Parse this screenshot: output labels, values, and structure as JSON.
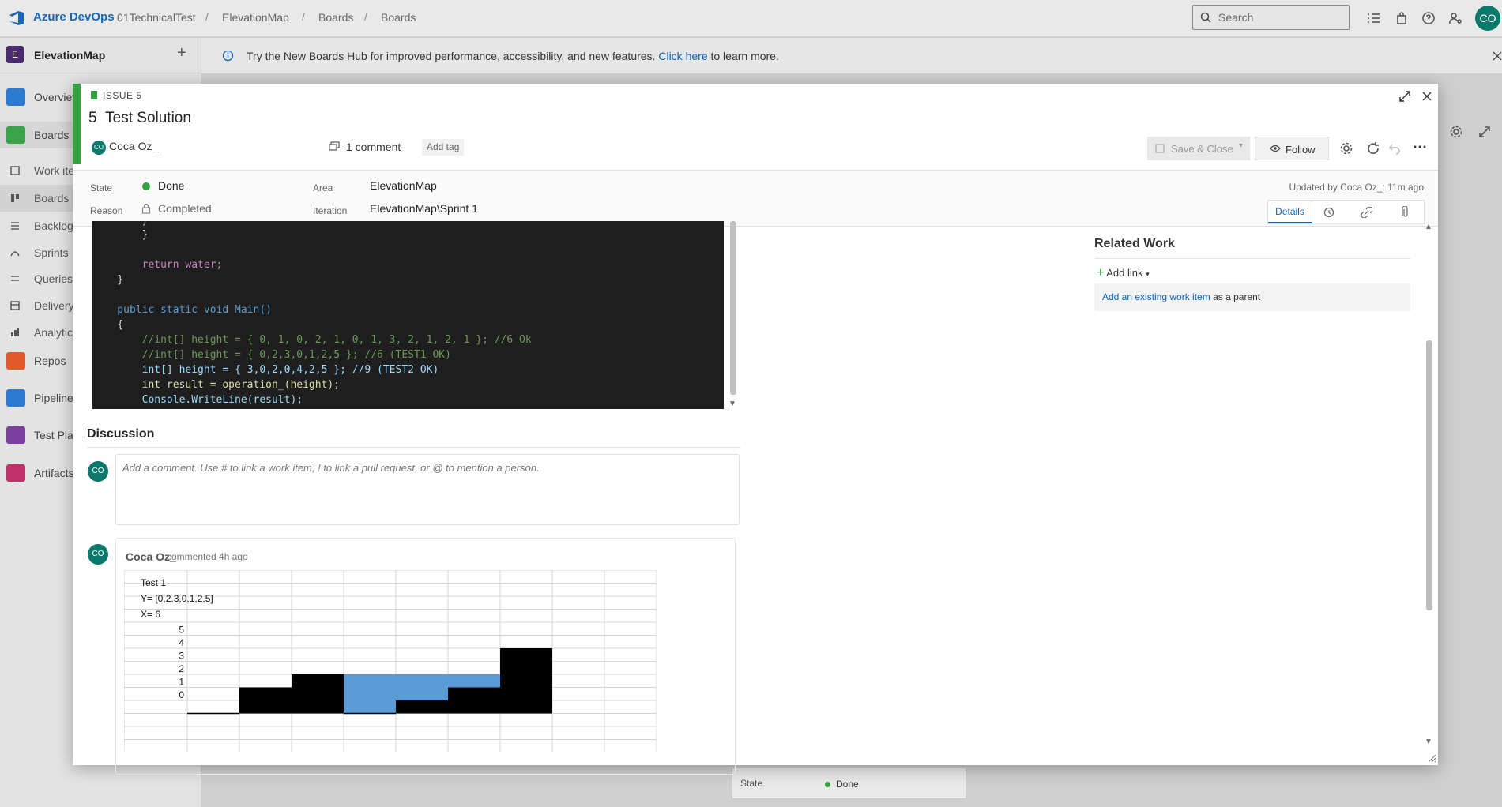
{
  "topbar": {
    "brand": "Azure DevOps",
    "breadcrumbs": [
      "01TechnicalTest",
      "ElevationMap",
      "Boards",
      "Boards"
    ],
    "search_placeholder": "Search",
    "avatar_initials": "CO"
  },
  "sidebar": {
    "project_initial": "E",
    "project_name": "ElevationMap",
    "items": [
      {
        "label": "Overview",
        "color": "#2b7bd0"
      },
      {
        "label": "Boards",
        "color": "#3aa44a"
      },
      {
        "label": "Work items",
        "color": ""
      },
      {
        "label": "Boards",
        "color": ""
      },
      {
        "label": "Backlogs",
        "color": ""
      },
      {
        "label": "Sprints",
        "color": ""
      },
      {
        "label": "Queries",
        "color": ""
      },
      {
        "label": "Delivery Plans",
        "color": ""
      },
      {
        "label": "Analytics views",
        "color": ""
      },
      {
        "label": "Repos",
        "color": "#e05a2a"
      },
      {
        "label": "Pipelines",
        "color": "#2b7bd0"
      },
      {
        "label": "Test Plans",
        "color": "#7b3fa0"
      },
      {
        "label": "Artifacts",
        "color": "#c0306a"
      }
    ]
  },
  "banner": {
    "text_before": "Try the New Boards Hub for improved performance, accessibility, and new features.",
    "link": "Click here",
    "text_after": "to learn more."
  },
  "work_item": {
    "type": "ISSUE 5",
    "id": "5",
    "title": "Test Solution",
    "assignee": "Coca Oz_",
    "assignee_initials": "CO",
    "comments": "1 comment",
    "add_tag": "Add tag",
    "save_close": "Save & Close",
    "follow": "Follow",
    "fields": {
      "state_label": "State",
      "state": "Done",
      "reason_label": "Reason",
      "reason": "Completed",
      "area_label": "Area",
      "area": "ElevationMap",
      "iteration_label": "Iteration",
      "iteration": "ElevationMap\\Sprint 1"
    },
    "updated": "Updated by Coca Oz_: 11m ago",
    "tab_details": "Details",
    "status_color": "#35a241"
  },
  "code_lines": [
    "        }",
    "",
    "        return water;",
    "    }",
    "",
    "    public static void Main()",
    "    {",
    "        //int[] height = { 0, 1, 0, 2, 1, 0, 1, 3, 2, 1, 2, 1 }; //6 Ok",
    "        //int[] height = { 0,2,3,0,1,2,5 }; //6 (TEST1 OK)",
    "        int[] height = { 3,0,2,0,4,2,5 }; //9 (TEST2 OK)",
    "        int result = operation_(height);",
    "        Console.WriteLine(result);"
  ],
  "discussion": {
    "heading": "Discussion",
    "placeholder": "Add a comment. Use # to link a work item, ! to link a pull request, or @ to mention a person.",
    "comment": {
      "author": "Coca Oz_",
      "meta": "commented 4h ago",
      "sheet_lines": [
        "Test 1",
        "Y= [0,2,3,0,1,2,5]",
        "X= 6"
      ],
      "y_labels": [
        "5",
        "4",
        "3",
        "2",
        "1",
        "0"
      ],
      "heights": [
        0,
        2,
        3,
        0,
        1,
        2,
        5
      ],
      "water": [
        0,
        0,
        0,
        3,
        2,
        1,
        0
      ]
    }
  },
  "related": {
    "heading": "Related Work",
    "add_link": "Add link",
    "parent_link": "Add an existing work item",
    "parent_suffix": "as a parent"
  },
  "background_card": {
    "state_label": "State",
    "state": "Done"
  }
}
